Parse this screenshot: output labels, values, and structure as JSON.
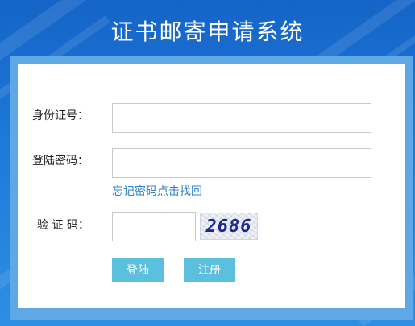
{
  "page": {
    "title": "证书邮寄申请系统"
  },
  "form": {
    "id_label": "身份证号：",
    "id_value": "",
    "password_label": "登陆密码：",
    "password_value": "",
    "forgot_link": "忘记密码点击找回",
    "captcha_label": "验 证 码：",
    "captcha_value": "",
    "captcha_code": "2686"
  },
  "buttons": {
    "login": "登陆",
    "register": "注册"
  },
  "colors": {
    "button_bg": "#5bc0de",
    "link": "#2f7fd0",
    "background": "#1e7ad8"
  }
}
